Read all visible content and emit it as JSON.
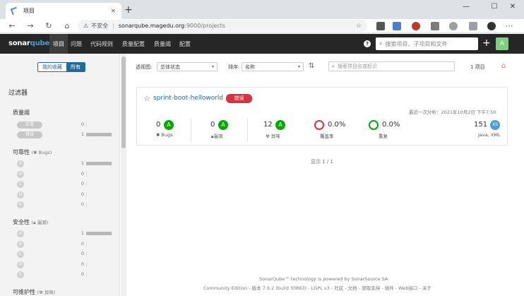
{
  "browser": {
    "tab_title": "项目",
    "tab_close": "×",
    "new_tab": "+",
    "win_min": "—",
    "win_max": "☐",
    "win_close": "✕",
    "not_secure": "不安全",
    "url_host": "sonarqube.magedu.org",
    "url_path": ":9000/projects"
  },
  "nav": {
    "logo_text": "sonar",
    "logo_accent": "qube",
    "items": [
      "项目",
      "问题",
      "代码规则",
      "质量配置",
      "质量阈",
      "配置"
    ],
    "help": "?",
    "search_placeholder": "搜索项目、子项目和文件",
    "plus": "+",
    "avatar": "A"
  },
  "sidebar": {
    "toggle_fav": "我的收藏",
    "toggle_all": "所有",
    "filters_title": "过滤器",
    "quality_gate": {
      "title": "质量阈",
      "items": [
        {
          "label": "正常",
          "count": "0",
          "fraction": 0
        },
        {
          "label": "错误",
          "count": "1",
          "fraction": 1
        }
      ]
    },
    "reliability": {
      "title": "可靠性",
      "sub": "Bugs",
      "items": [
        {
          "label": "A",
          "count": "1",
          "fraction": 1
        },
        {
          "label": "B",
          "count": "0",
          "fraction": 0
        },
        {
          "label": "C",
          "count": "0",
          "fraction": 0
        },
        {
          "label": "D",
          "count": "0",
          "fraction": 0
        },
        {
          "label": "E",
          "count": "0",
          "fraction": 0
        }
      ]
    },
    "security": {
      "title": "安全性",
      "sub": "漏洞",
      "items": [
        {
          "label": "A",
          "count": "1",
          "fraction": 1
        },
        {
          "label": "B",
          "count": "0",
          "fraction": 0
        },
        {
          "label": "C",
          "count": "0",
          "fraction": 0
        },
        {
          "label": "D",
          "count": "0",
          "fraction": 0
        },
        {
          "label": "E",
          "count": "0",
          "fraction": 0
        }
      ]
    },
    "maintainability": {
      "title": "可维护性",
      "sub": "异味"
    }
  },
  "toolbar": {
    "view_label": "透视图:",
    "view_value": "总体状态",
    "sort_label": "排序:",
    "sort_value": "名称",
    "search_placeholder": "搜索项目名或标识",
    "count": "1 项目"
  },
  "project": {
    "name": "sprint-boot-helloworld",
    "status": "错误",
    "last_analysis": "最近一次分析：2021年10月2日 下午7:50",
    "bugs": {
      "value": "0",
      "grade": "A",
      "label": "Bugs"
    },
    "vulnerabilities": {
      "value": "0",
      "grade": "A",
      "label": "漏洞"
    },
    "code_smells": {
      "value": "12",
      "grade": "A",
      "label": "异味"
    },
    "coverage": {
      "value": "0.0%",
      "label": "覆盖率"
    },
    "duplications": {
      "value": "0.0%",
      "label": "重复"
    },
    "size": {
      "value": "151",
      "badge": "XS",
      "label": "Java, XML"
    }
  },
  "pager": "显示 1 / 1",
  "footer": {
    "line1": "SonarQube™ technology is powered by SonarSource SA",
    "line2": "Community Edition - 版本 7.9.2 (build 30863) - LGPL v3 - 社区 - 文档 - 获取支持 - 插件 - Web接口 - 关于"
  },
  "colors": {
    "accent": "#236a97",
    "error": "#d4333f",
    "good": "#00aa00",
    "navbar": "#262626"
  }
}
